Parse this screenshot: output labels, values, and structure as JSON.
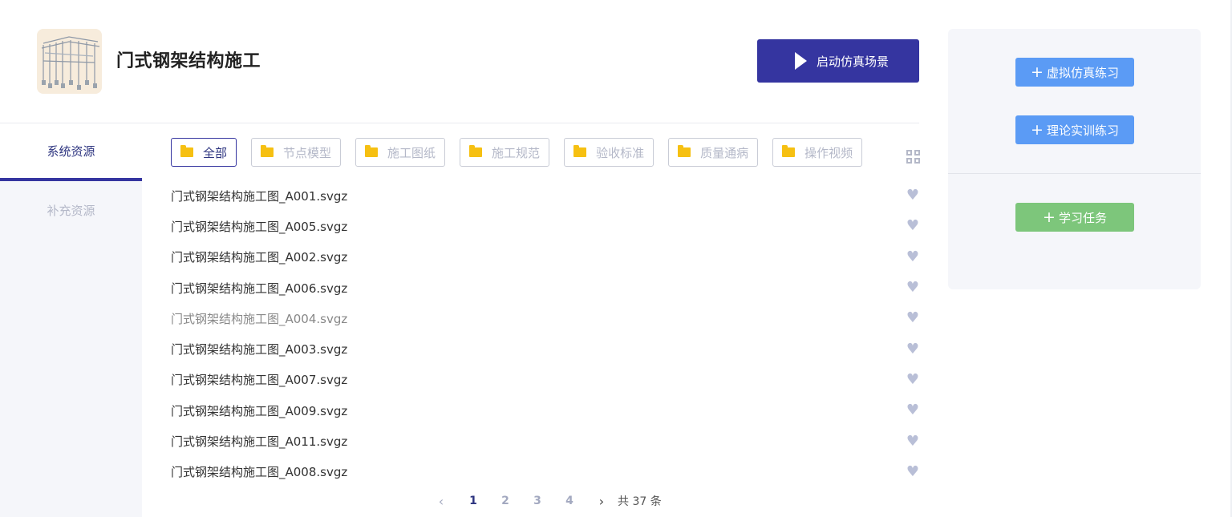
{
  "course": {
    "title": "门式钢架结构施工",
    "launch_label": "启动仿真场景"
  },
  "nav": {
    "items": [
      {
        "label": "系统资源",
        "active": true
      },
      {
        "label": "补充资源",
        "active": false
      }
    ]
  },
  "categories": [
    {
      "label": "全部",
      "active": true
    },
    {
      "label": "节点模型"
    },
    {
      "label": "施工图纸"
    },
    {
      "label": "施工规范"
    },
    {
      "label": "验收标准"
    },
    {
      "label": "质量通病"
    },
    {
      "label": "操作视频"
    }
  ],
  "files": [
    "门式钢架结构施工图_A001.svgz",
    "门式钢架结构施工图_A005.svgz",
    "门式钢架结构施工图_A002.svgz",
    "门式钢架结构施工图_A006.svgz",
    "门式钢架结构施工图_A004.svgz",
    "门式钢架结构施工图_A003.svgz",
    "门式钢架结构施工图_A007.svgz",
    "门式钢架结构施工图_A009.svgz",
    "门式钢架结构施工图_A011.svgz",
    "门式钢架结构施工图_A008.svgz"
  ],
  "pagination": {
    "pages": [
      "1",
      "2",
      "3",
      "4"
    ],
    "current": "1",
    "total_text": "共 37 条"
  },
  "actions": {
    "virtual_practice": "虚拟仿真练习",
    "theory_practice": "理论实训练习",
    "learning_task": "学习任务"
  },
  "colors": {
    "primary": "#3535a0",
    "blue_button": "#5b9bf5",
    "green_button": "#7dc67b",
    "folder": "#f6c012",
    "heart": "#b9bfd7"
  }
}
